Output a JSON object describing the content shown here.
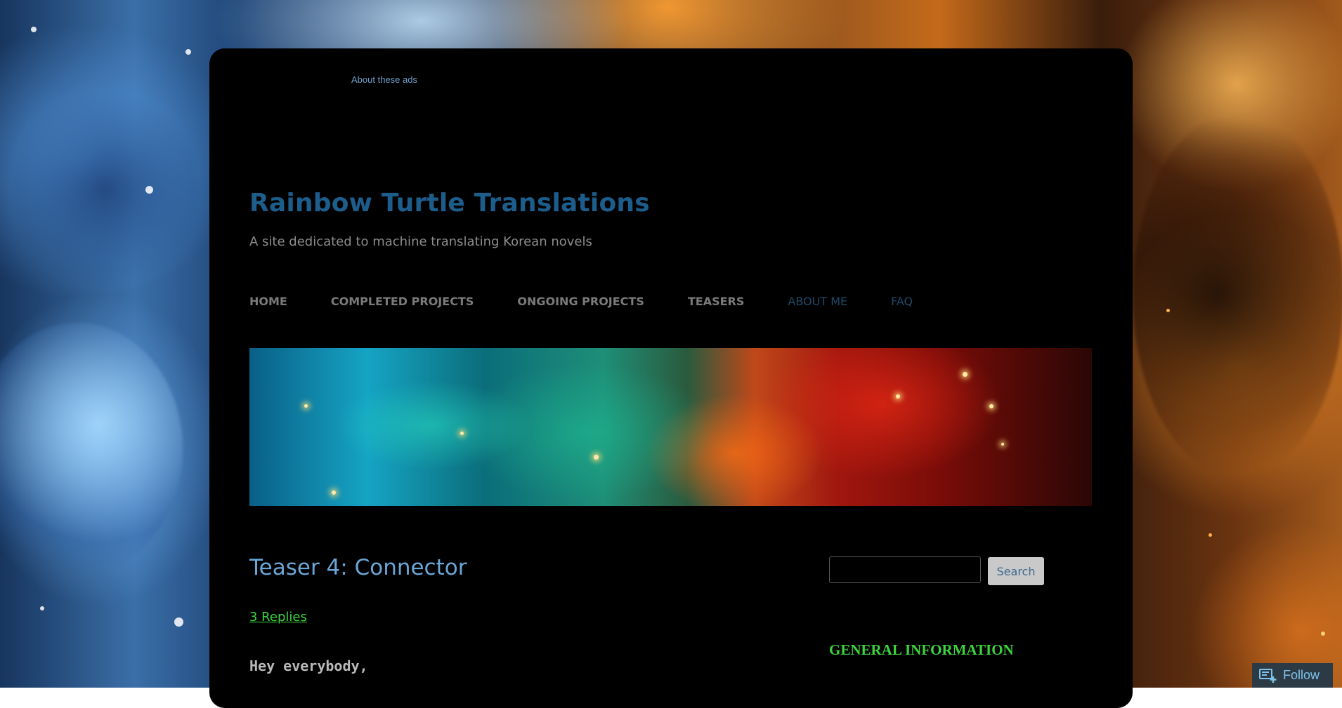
{
  "ads": {
    "about_label": "About these ads"
  },
  "site": {
    "title": "Rainbow Turtle Translations",
    "tagline": "A site dedicated to machine translating Korean novels"
  },
  "nav": {
    "items": [
      {
        "label": "HOME"
      },
      {
        "label": "COMPLETED PROJECTS"
      },
      {
        "label": "ONGOING PROJECTS"
      },
      {
        "label": "TEASERS"
      },
      {
        "label": "ABOUT ME"
      },
      {
        "label": "FAQ"
      }
    ]
  },
  "post": {
    "title": "Teaser 4: Connector",
    "replies": "3 Replies",
    "greeting": "Hey everybody,"
  },
  "sidebar": {
    "search": {
      "value": "",
      "button_label": "Search"
    },
    "widget_title": "GENERAL INFORMATION"
  },
  "follow": {
    "label": "Follow",
    "icon": "follow-blog-icon"
  },
  "colors": {
    "page_background": "#000000",
    "title": "#1d5d8c",
    "post_title": "#6aa6d6",
    "accent_green": "#3cd33c",
    "nav_text": "#7a7a7a",
    "nav_dim": "#1f4968"
  }
}
